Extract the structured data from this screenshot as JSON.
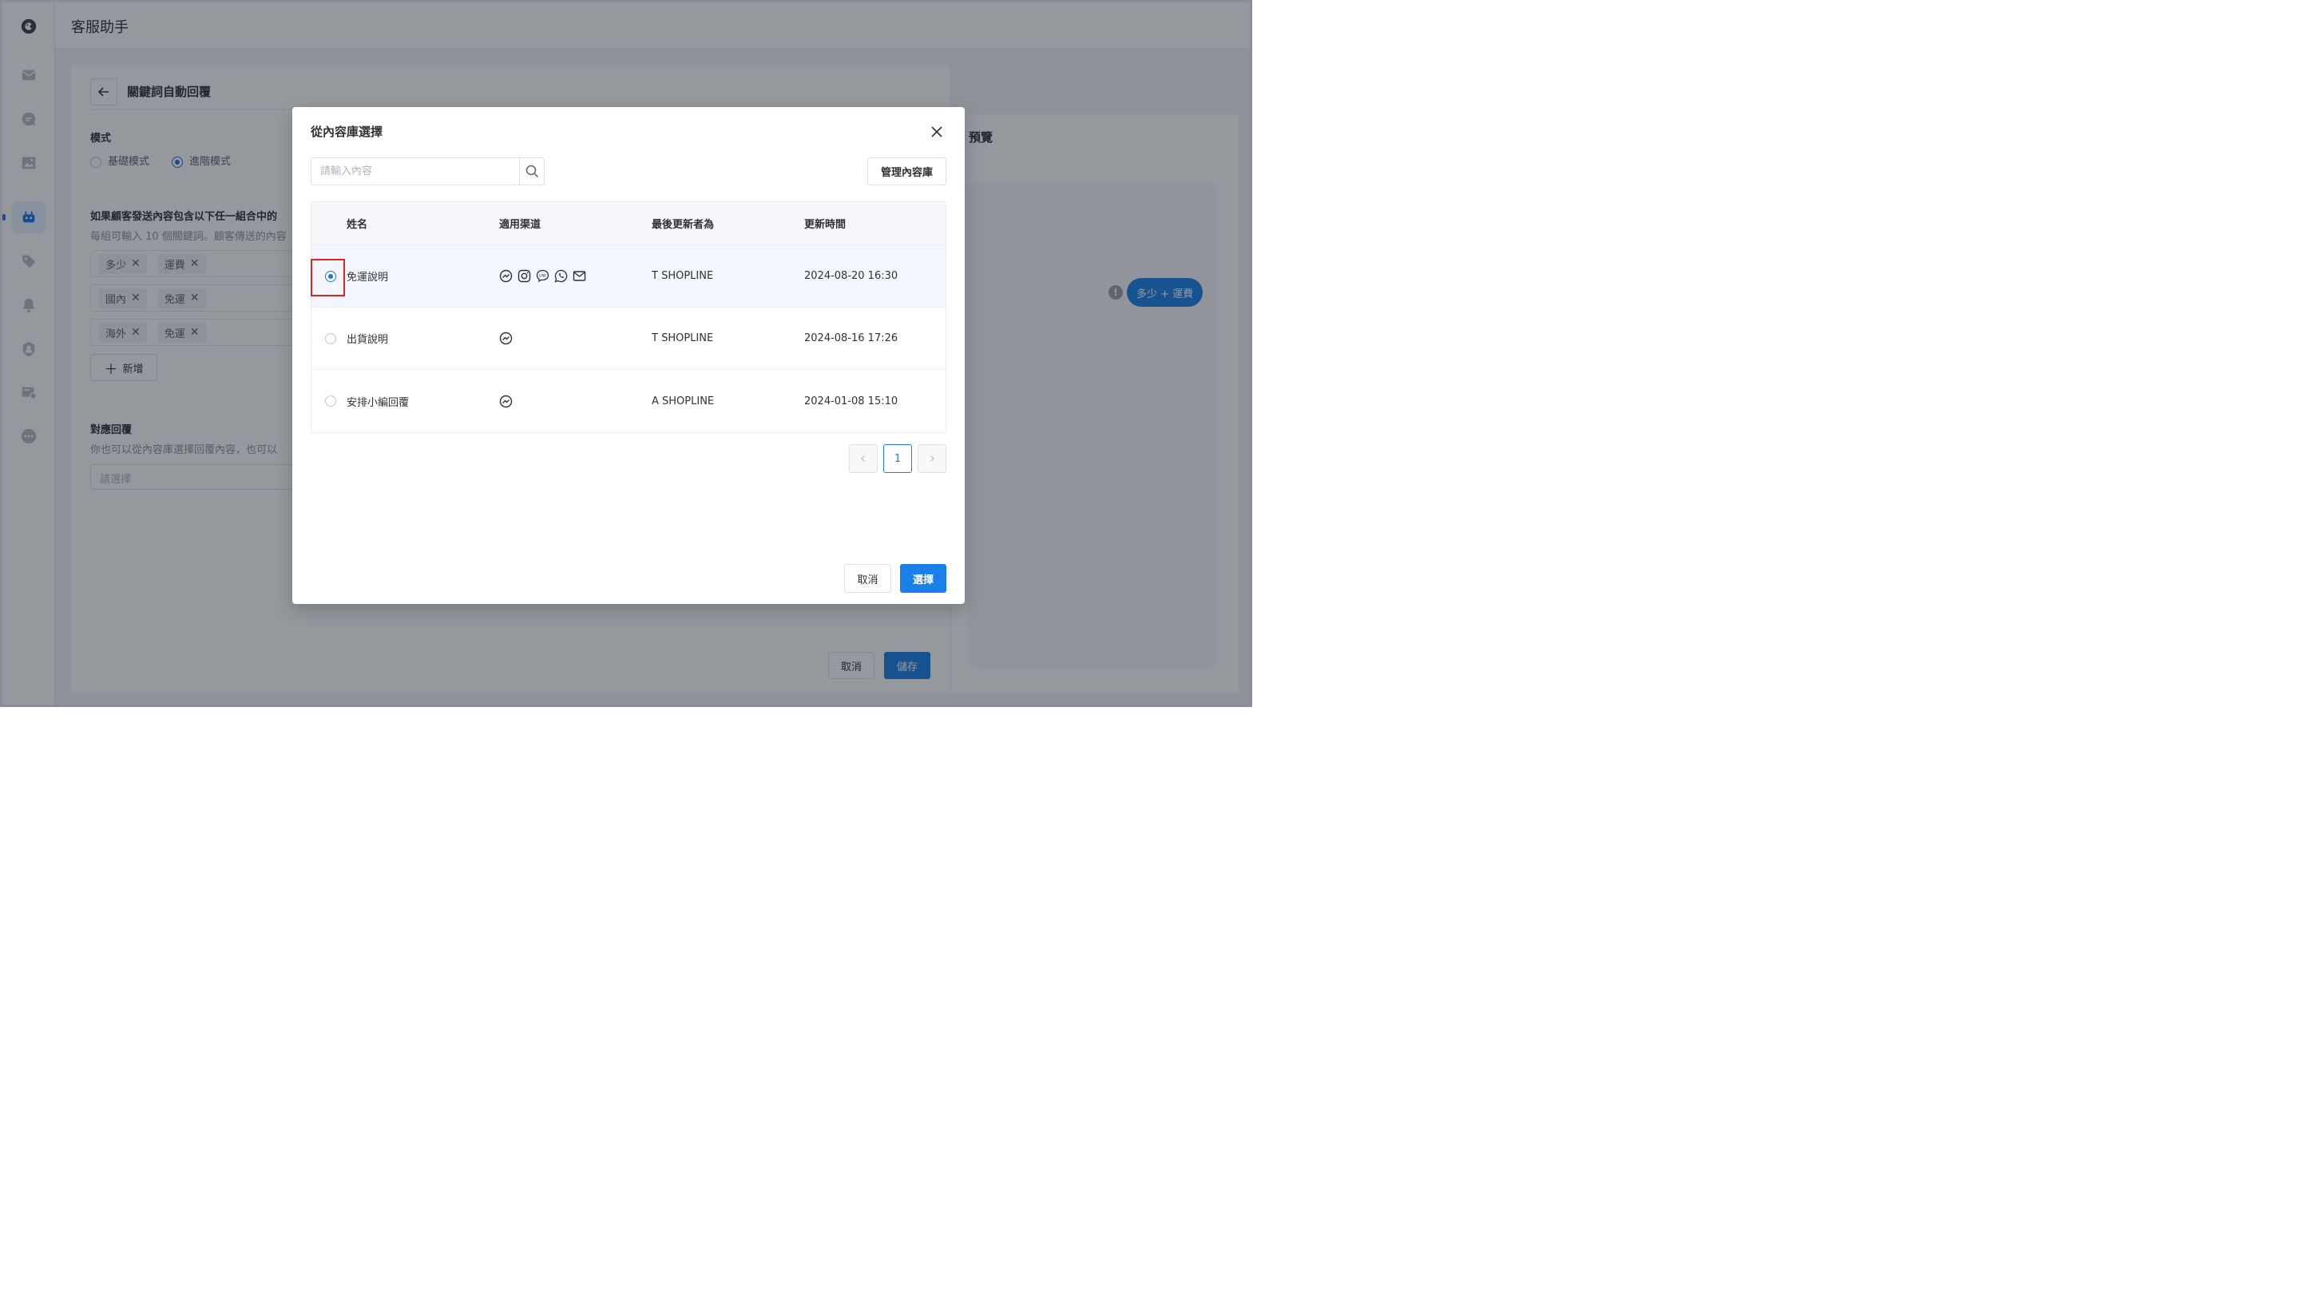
{
  "app": {
    "title": "客服助手"
  },
  "page": {
    "title": "關鍵詞自動回覆"
  },
  "mode": {
    "label": "模式",
    "options": [
      {
        "label": "基礎模式",
        "selected": false
      },
      {
        "label": "進階模式",
        "selected": true
      }
    ]
  },
  "keywords": {
    "title": "如果顧客發送內容包含以下任一組合中的",
    "hint": "每組可輸入 10 個關鍵詞。顧客傳送的內容",
    "groups": [
      [
        "多少",
        "運費"
      ],
      [
        "國內",
        "免運"
      ],
      [
        "海外",
        "免運"
      ]
    ],
    "add_label": "新增"
  },
  "reply": {
    "title": "對應回覆",
    "hint": "你也可以從內容庫選擇回覆內容，也可以",
    "placeholder": "請選擇"
  },
  "footer": {
    "cancel": "取消",
    "save": "儲存"
  },
  "preview": {
    "title": "預覽",
    "bubble": "多少 + 運費"
  },
  "modal": {
    "title": "從內容庫選擇",
    "search_placeholder": "請輸入內容",
    "manage_label": "管理內容庫",
    "columns": [
      "姓名",
      "適用渠道",
      "最後更新者為",
      "更新時間"
    ],
    "rows": [
      {
        "name": "免運說明",
        "channels": [
          "messenger-icon",
          "instagram-icon",
          "line-icon",
          "whatsapp-icon",
          "email-icon"
        ],
        "updated_by": "T SHOPLINE",
        "updated_at": "2024-08-20 16:30",
        "selected": true
      },
      {
        "name": "出貨說明",
        "channels": [
          "messenger-icon"
        ],
        "updated_by": "T SHOPLINE",
        "updated_at": "2024-08-16 17:26",
        "selected": false
      },
      {
        "name": "安排小編回覆",
        "channels": [
          "messenger-icon"
        ],
        "updated_by": "A SHOPLINE",
        "updated_at": "2024-01-08 15:10",
        "selected": false
      }
    ],
    "pagination": {
      "current": "1"
    },
    "cancel_label": "取消",
    "confirm_label": "選擇"
  },
  "colors": {
    "primary": "#1a7fe8",
    "highlight": "#e02424"
  }
}
